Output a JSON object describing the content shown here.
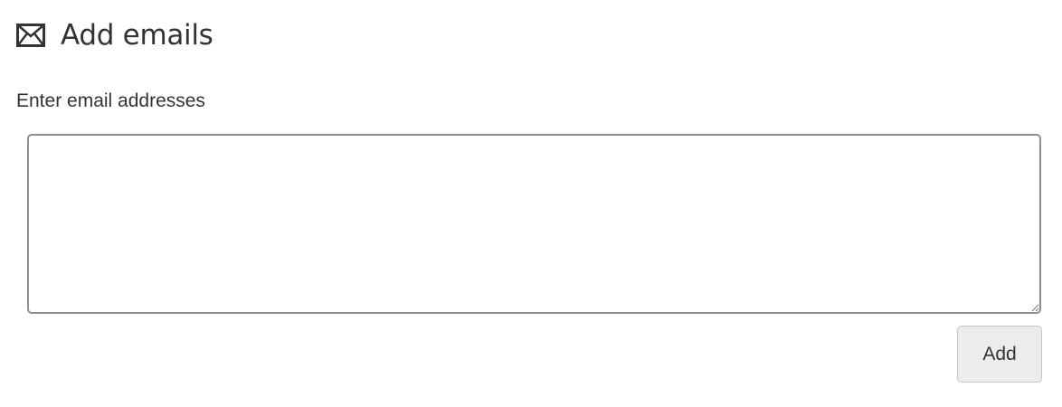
{
  "header": {
    "icon": "envelope-icon",
    "title": "Add emails"
  },
  "form": {
    "label": "Enter email addresses",
    "textarea_value": "",
    "add_button_label": "Add"
  },
  "colors": {
    "text": "#333333",
    "button_bg": "#ececec",
    "textarea_border": "#8f8f8f"
  }
}
